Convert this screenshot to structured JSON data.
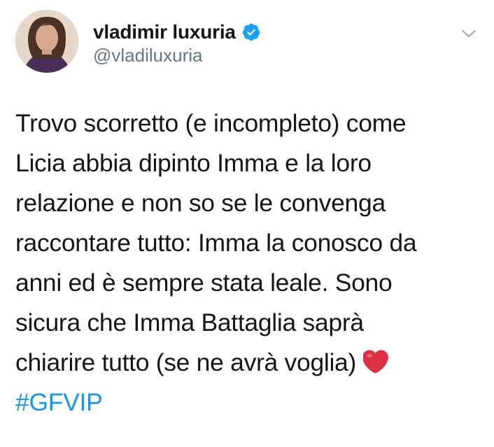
{
  "tweet": {
    "display_name": "vladimir luxuria",
    "handle": "@vladiluxuria",
    "verified": true,
    "text": "Trovo scorretto (e incompleto) come\nLicia abbia dipinto Imma e la loro\nrelazione e non so se le convenga\nraccontare tutto: Imma la conosco da\nanni ed è sempre stata leale. Sono\nsicura che Imma Battaglia saprà\nchiarire tutto (se ne avrà voglia)",
    "emoji": "heart-emoji",
    "hashtag": "#GFVIP"
  },
  "colors": {
    "text": "#14171a",
    "secondary": "#657786",
    "link": "#1b95e0",
    "verified": "#1da1f2",
    "heart": "#e0245e"
  },
  "icons": {
    "verified": "verified-badge-icon",
    "menu": "chevron-down-icon",
    "emoji": "red-heart-emoji"
  }
}
